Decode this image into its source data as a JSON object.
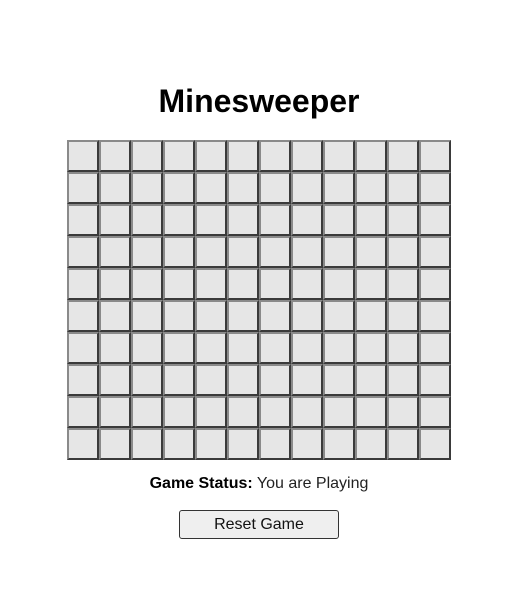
{
  "game": {
    "title": "Minesweeper",
    "rows": 10,
    "cols": 12,
    "cells_state": "all-unrevealed"
  },
  "status": {
    "label": "Game Status:",
    "value": "You are Playing"
  },
  "controls": {
    "reset_label": "Reset Game"
  },
  "colors": {
    "cell_face": "#e6e6e6",
    "cell_border_dark": "#3a3a3a",
    "button_bg": "#efefef"
  }
}
